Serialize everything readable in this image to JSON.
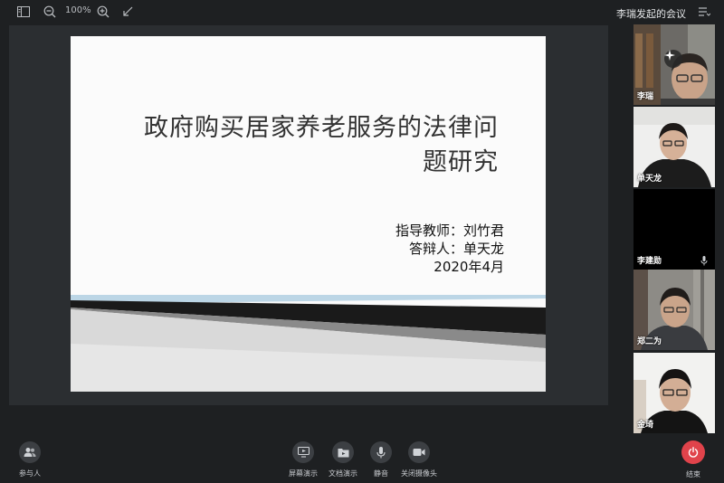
{
  "topbar": {
    "zoom_level": "100%",
    "meeting_title": "李瑞发起的会议",
    "icons": [
      "sidebar-toggle-icon",
      "zoom-out-icon",
      "zoom-in-icon",
      "collapse-icon",
      "list-icon"
    ]
  },
  "slide": {
    "title_line1": "政府购买居家养老服务的法律问",
    "title_line2": "题研究",
    "advisor": "指导教师：刘竹君",
    "defender": "答辩人：单天龙",
    "date": "2020年4月"
  },
  "participants": [
    {
      "name": "李瑞"
    },
    {
      "name": "单天龙"
    },
    {
      "name": "李建勋"
    },
    {
      "name": "郑二为"
    },
    {
      "name": "金琦"
    }
  ],
  "toolbar": {
    "participants_label": "参与人",
    "screen_share_label": "屏幕演示",
    "doc_share_label": "文档演示",
    "mute_label": "静音",
    "camera_off_label": "关闭摄像头",
    "end_label": "结束"
  },
  "colors": {
    "background": "#1e2022",
    "share_area": "#2b2e31",
    "end_button": "#e0434b",
    "tool_button": "#3c3f43"
  }
}
